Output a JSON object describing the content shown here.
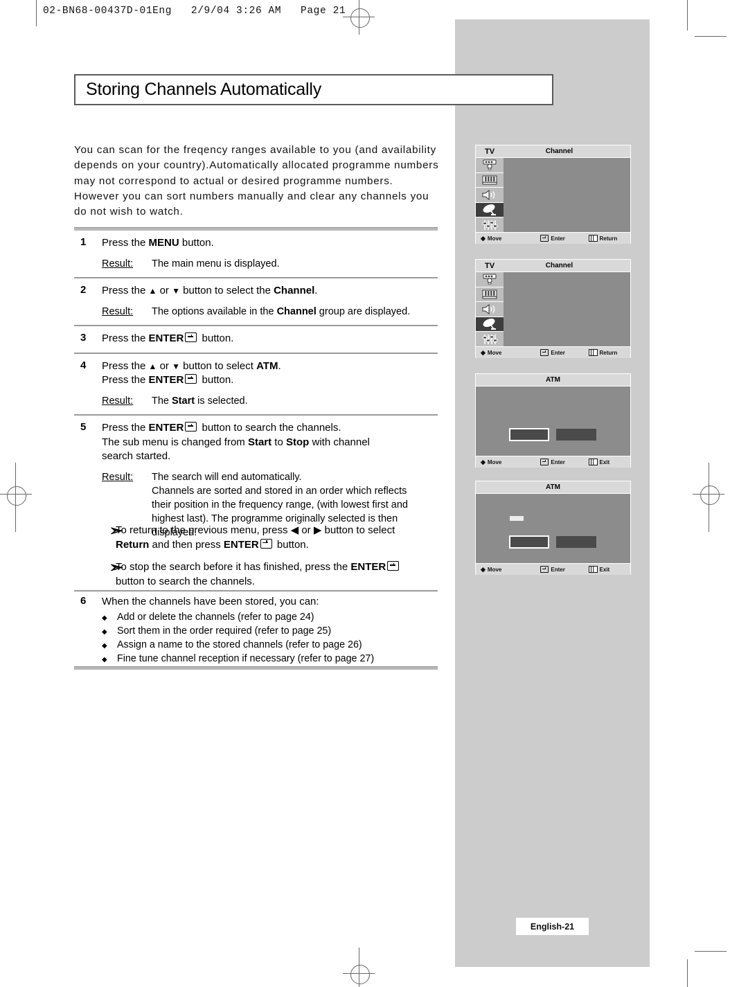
{
  "print_header": "02-BN68-00437D-01Eng   2/9/04 3:26 AM   Page 21",
  "page_title": "Storing Channels Automatically",
  "page_footer": "English-21",
  "intro_lines": [
    "You can scan for the freqency ranges available to you (and availability",
    "depends on your country).Automatically allocated programme numbers",
    "may not correspond to actual or desired programme numbers.",
    "However you can sort numbers manually and clear any channels you",
    "do not wish to watch."
  ],
  "steps": [
    {
      "num": "1",
      "lines": [
        {
          "pre": "Press the ",
          "bold": "MENU",
          "post": " button."
        }
      ],
      "result_label": "Result:",
      "result_lines": [
        {
          "pre": "The main menu is displayed.",
          "bold": "",
          "post": ""
        }
      ]
    },
    {
      "num": "2",
      "lines": [
        {
          "pre": "Press the ▲ or ▼ button to select the ",
          "bold": "Channel",
          "post": "."
        }
      ],
      "result_label": "Result:",
      "result_lines": [
        {
          "pre": "The options available in the ",
          "bold": "Channel",
          "post": " group are displayed."
        }
      ]
    },
    {
      "num": "3",
      "lines": [
        {
          "pre": "Press the ",
          "bold": "ENTER",
          "post": "⤵ button.",
          "enter": true
        }
      ],
      "result_label": "",
      "result_lines": []
    },
    {
      "num": "4",
      "lines": [
        {
          "pre": "Press the ▲ or ▼ button to select ",
          "bold": "ATM",
          "post": "."
        },
        {
          "pre": "Press the ",
          "bold": "ENTER",
          "post": " button.",
          "enter": true
        }
      ],
      "result_label": "Result:",
      "result_lines": [
        {
          "pre": "The ",
          "bold": "Start",
          "post": " is selected."
        }
      ]
    },
    {
      "num": "5",
      "lines": [
        {
          "pre": "Press the ",
          "bold": "ENTER",
          "post": " button to search the channels.",
          "enter": true
        },
        {
          "pre": "The sub menu is changed from ",
          "bold": "Start",
          "post": " to ",
          "bold2": "Stop",
          "post2": " with channel"
        },
        {
          "pre": "search started.",
          "bold": "",
          "post": ""
        }
      ],
      "result_label": "Result:",
      "result_lines": [
        {
          "pre": "The search will end automatically.",
          "bold": "",
          "post": ""
        },
        {
          "pre": "Channels are sorted and stored in an order which reflects",
          "bold": "",
          "post": ""
        },
        {
          "pre": "their position in the frequency range, (with lowest first and",
          "bold": "",
          "post": ""
        },
        {
          "pre": "highest last). The programme originally selected is then",
          "bold": "",
          "post": ""
        },
        {
          "pre": "displayed.",
          "bold": "",
          "post": ""
        }
      ]
    }
  ],
  "notes": [
    {
      "lines": [
        {
          "pre": "To return to the previous menu, press ◀ or ▶ button to select",
          "bold": "",
          "post": ""
        },
        {
          "pre": "",
          "bold": "Return",
          "post": " and then press ",
          "bold2": "ENTER",
          "post2": " button.",
          "enter": true
        }
      ]
    },
    {
      "lines": [
        {
          "pre": "To stop the search before it has finished, press the ",
          "bold": "ENTER",
          "post": "",
          "enter": true
        },
        {
          "pre": "button to search the channels.",
          "bold": "",
          "post": ""
        }
      ]
    }
  ],
  "step6": {
    "num": "6",
    "intro": "When the channels have been stored, you can:",
    "bullets": [
      "Add or delete the channels (refer to page 24)",
      "Sort them in the order required (refer to page 25)",
      "Assign a name to the stored channels (refer to page 26)",
      "Fine tune channel reception if necessary (refer to page 27)"
    ]
  },
  "osd_panels": [
    {
      "id": "osd-1",
      "tv_label": "TV",
      "group_title": "Channel",
      "icons": [
        "picture-icon",
        "bars-icon",
        "speaker-icon",
        "satellite-dish-icon",
        "sliders-icon"
      ],
      "selected_icon_index": 3,
      "footer": [
        {
          "glyph": "updown-arrows-icon",
          "label": "Move"
        },
        {
          "glyph": "enter-key-icon",
          "label": "Enter"
        },
        {
          "glyph": "menu-key-icon",
          "label": "Return"
        }
      ]
    },
    {
      "id": "osd-2",
      "tv_label": "TV",
      "group_title": "Channel",
      "icons": [
        "picture-icon",
        "bars-icon",
        "speaker-icon",
        "satellite-dish-icon",
        "sliders-icon"
      ],
      "selected_icon_index": 3,
      "footer": [
        {
          "glyph": "updown-arrows-icon",
          "label": "Move"
        },
        {
          "glyph": "enter-key-icon",
          "label": "Enter"
        },
        {
          "glyph": "menu-key-icon",
          "label": "Return"
        }
      ]
    },
    {
      "id": "osd-3",
      "title": "ATM",
      "has_progress_bar": false,
      "footer": [
        {
          "glyph": "leftright-arrows-icon",
          "label": "Move"
        },
        {
          "glyph": "enter-key-icon",
          "label": "Enter"
        },
        {
          "glyph": "menu-key-icon",
          "label": "Exit"
        }
      ]
    },
    {
      "id": "osd-4",
      "title": "ATM",
      "has_progress_bar": true,
      "footer": [
        {
          "glyph": "leftright-arrows-icon",
          "label": "Move"
        },
        {
          "glyph": "enter-key-icon",
          "label": "Enter"
        },
        {
          "glyph": "menu-key-icon",
          "label": "Exit"
        }
      ]
    }
  ],
  "colors": {
    "gray_band": "#cccccc",
    "osd_body": "#8c8c8c",
    "osd_header": "#d9d9d9",
    "osd_selected": "#3d3d3d",
    "osd_box": "#4a4a4a",
    "rule": "#b9b9b9"
  }
}
